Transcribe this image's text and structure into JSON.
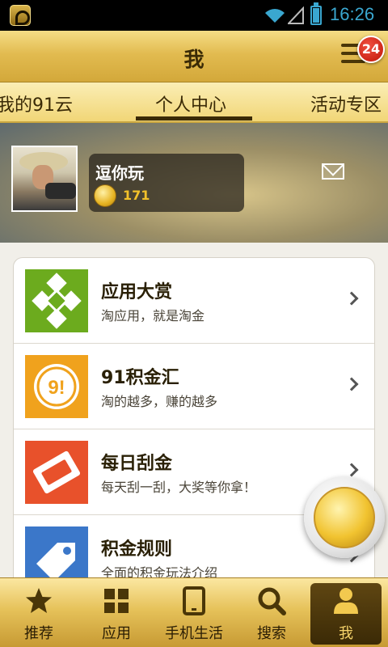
{
  "status_bar": {
    "time": "16:26",
    "battery_level": 0.8
  },
  "title_bar": {
    "title": "我",
    "notification_count": "24"
  },
  "tabs": [
    {
      "label": "我的91云",
      "active": false
    },
    {
      "label": "个人中心",
      "active": true
    },
    {
      "label": "活动专区",
      "active": false
    }
  ],
  "profile": {
    "username": "逗你玩",
    "points": "171"
  },
  "list": [
    {
      "title": "应用大赏",
      "subtitle": "淘应用，就是淘金",
      "icon": "app-gallery-icon",
      "color": "#6cab1e"
    },
    {
      "title": "91积金汇",
      "subtitle": "淘的越多，赚的越多",
      "icon": "91-points-icon",
      "color": "#f0a21d"
    },
    {
      "title": "每日刮金",
      "subtitle": "每天刮一刮，大奖等你拿！",
      "icon": "scratch-card-icon",
      "color": "#e8512b"
    },
    {
      "title": "积金规则",
      "subtitle": "全面的积金玩法介绍",
      "icon": "tag-rules-icon",
      "color": "#3b77c9"
    }
  ],
  "bottom_nav": [
    {
      "label": "推荐",
      "icon": "star-icon",
      "active": false
    },
    {
      "label": "应用",
      "icon": "grid-icon",
      "active": false
    },
    {
      "label": "手机生活",
      "icon": "tablet-icon",
      "active": false
    },
    {
      "label": "搜索",
      "icon": "search-icon",
      "active": false
    },
    {
      "label": "我",
      "icon": "person-icon",
      "active": true
    }
  ],
  "colors": {
    "accent_gold": "#e2bb50",
    "dark_brown": "#3a2a06"
  }
}
